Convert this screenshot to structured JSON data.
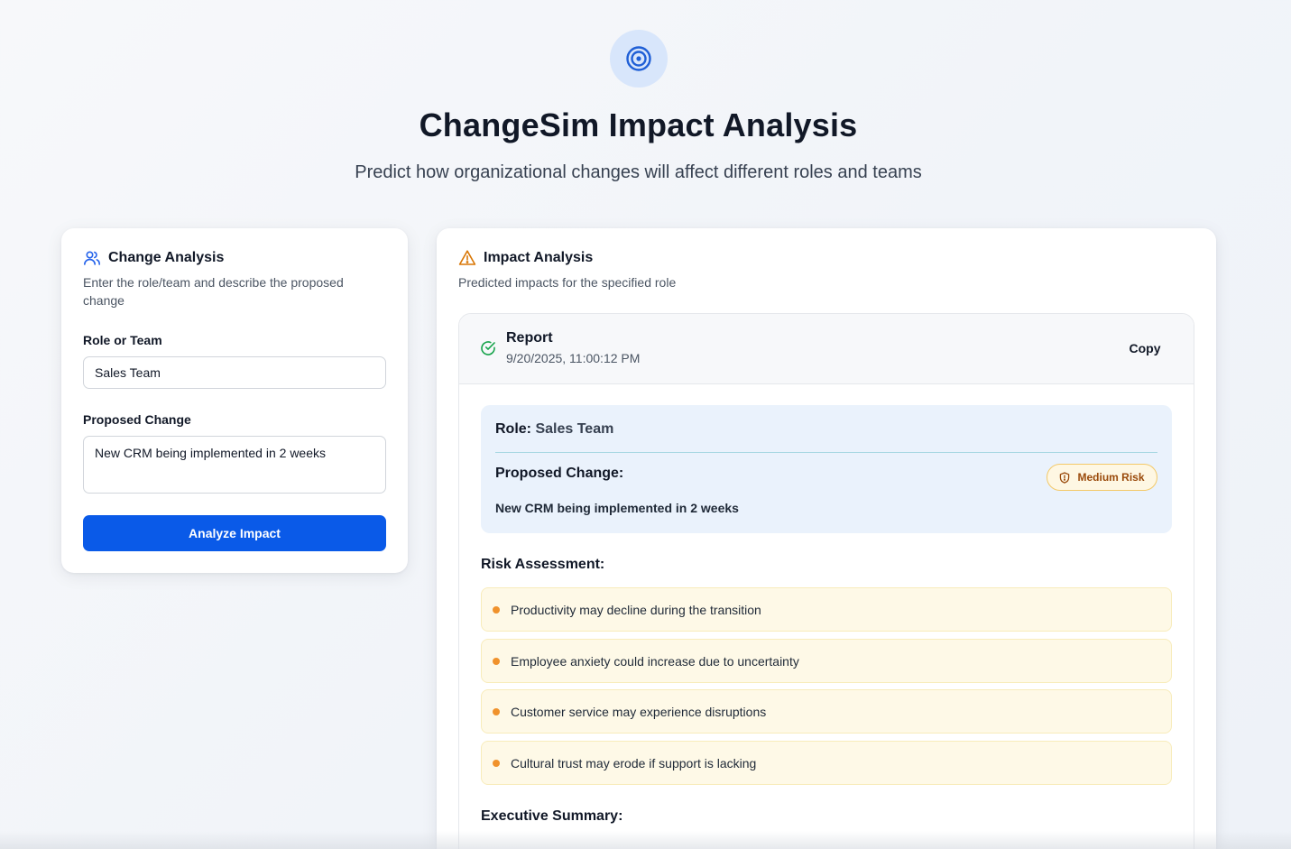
{
  "header": {
    "icon": "target-icon",
    "title": "ChangeSim Impact Analysis",
    "subtitle": "Predict how organizational changes will affect different roles and teams"
  },
  "change_analysis": {
    "icon": "users-icon",
    "title": "Change Analysis",
    "description": "Enter the role/team and describe the proposed change",
    "role_label": "Role or Team",
    "role_value": "Sales Team",
    "change_label": "Proposed Change",
    "change_value": "New CRM being implemented in 2 weeks",
    "button_label": "Analyze Impact"
  },
  "impact_analysis": {
    "icon": "warning-triangle-icon",
    "title": "Impact Analysis",
    "description": "Predicted impacts for the specified role",
    "report": {
      "status_icon": "check-circle-icon",
      "title": "Report",
      "timestamp": "9/20/2025, 11:00:12 PM",
      "copy_label": "Copy",
      "role_label": "Role:",
      "role_value": "Sales Team",
      "change_label": "Proposed Change:",
      "change_value": "New CRM being implemented in 2 weeks",
      "risk_badge": "Medium Risk",
      "risk_badge_icon": "shield-icon",
      "risk_heading": "Risk Assessment:",
      "risks": [
        "Productivity may decline during the transition",
        "Employee anxiety could increase due to uncertainty",
        "Customer service may experience disruptions",
        "Cultural trust may erode if support is lacking"
      ],
      "summary_heading": "Executive Summary:"
    }
  },
  "colors": {
    "primary": "#0a5ae8",
    "warning": "#f0922c",
    "success": "#16a34a"
  }
}
